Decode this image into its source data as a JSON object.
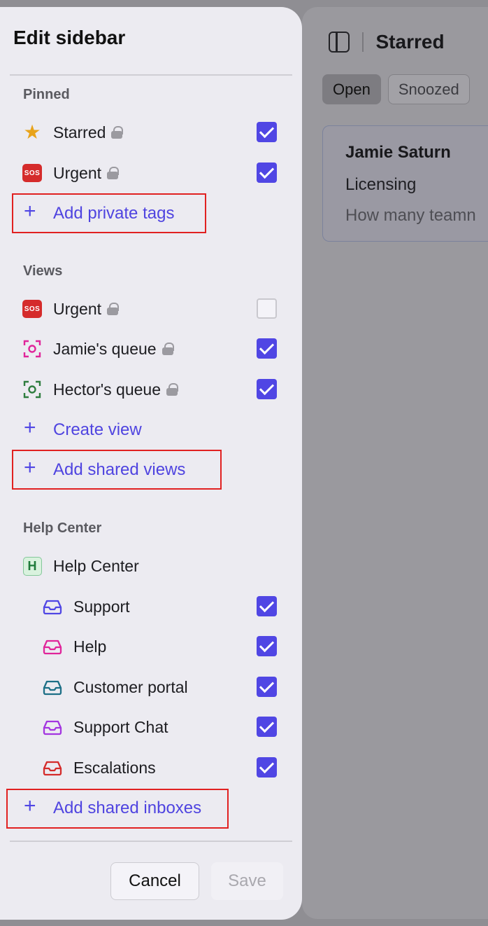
{
  "panel": {
    "title": "Edit sidebar",
    "sections": {
      "pinned": {
        "label": "Pinned",
        "items": [
          {
            "label": "Starred",
            "icon": "star-icon",
            "checked": true
          },
          {
            "label": "Urgent",
            "icon": "sos-icon",
            "checked": true
          }
        ],
        "add_label": "Add private tags"
      },
      "views": {
        "label": "Views",
        "items": [
          {
            "label": "Urgent",
            "icon": "sos-icon",
            "checked": false
          },
          {
            "label": "Jamie's queue",
            "icon": "view-icon",
            "color": "#e0249a",
            "checked": true
          },
          {
            "label": "Hector's queue",
            "icon": "view-icon",
            "color": "#2f7d3f",
            "checked": true
          }
        ],
        "create_label": "Create view",
        "add_label": "Add shared views"
      },
      "help_center": {
        "label": "Help Center",
        "group": {
          "label": "Help Center",
          "badge": "H"
        },
        "items": [
          {
            "label": "Support",
            "icon": "inbox-icon",
            "color": "#5046e4",
            "checked": true
          },
          {
            "label": "Help",
            "icon": "inbox-icon",
            "color": "#e0249a",
            "checked": true
          },
          {
            "label": "Customer portal",
            "icon": "inbox-icon",
            "color": "#1d6f86",
            "checked": true
          },
          {
            "label": "Support Chat",
            "icon": "inbox-icon",
            "color": "#a335e0",
            "checked": true
          },
          {
            "label": "Escalations",
            "icon": "inbox-icon",
            "color": "#d42b2b",
            "checked": true
          }
        ],
        "add_label": "Add shared inboxes"
      }
    },
    "sos_text": "SOS",
    "footer": {
      "cancel": "Cancel",
      "save": "Save"
    }
  },
  "background": {
    "title": "Starred",
    "tabs": [
      "Open",
      "Snoozed"
    ],
    "card": {
      "name": "Jamie Saturn",
      "subject": "Licensing",
      "preview": "How many teamn"
    }
  },
  "colors": {
    "accent": "#5046e4",
    "highlight": "#e12121"
  }
}
